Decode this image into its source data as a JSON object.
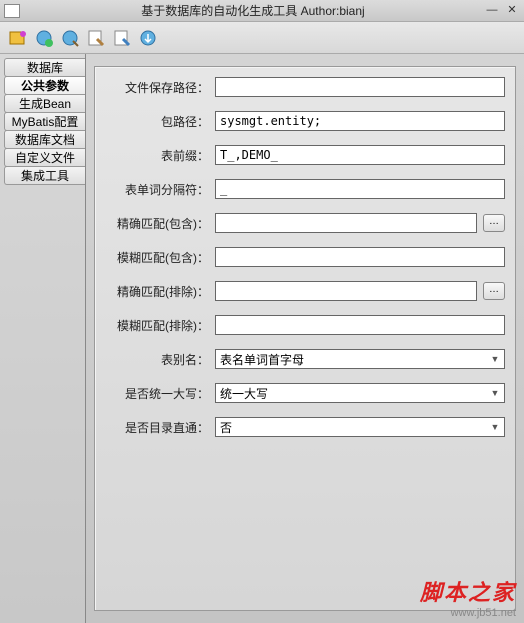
{
  "window": {
    "title": "基于数据库的自动化生成工具 Author:bianj"
  },
  "sidebar": {
    "tabs": [
      {
        "label": "数据库"
      },
      {
        "label": "公共参数"
      },
      {
        "label": "生成Bean"
      },
      {
        "label": "MyBatis配置"
      },
      {
        "label": "数据库文档"
      },
      {
        "label": "自定义文件"
      },
      {
        "label": "集成工具"
      }
    ]
  },
  "form": {
    "file_save_path": {
      "label": "文件保存路径：",
      "value": ""
    },
    "package_path": {
      "label": "包路径：",
      "value": "sysmgt.entity;"
    },
    "table_prefix": {
      "label": "表前缀：",
      "value": "T_,DEMO_"
    },
    "word_separator": {
      "label": "表单词分隔符：",
      "value": "_"
    },
    "exact_include": {
      "label": "精确匹配(包含)：",
      "value": ""
    },
    "fuzzy_include": {
      "label": "模糊匹配(包含)：",
      "value": ""
    },
    "exact_exclude": {
      "label": "精确匹配(排除)：",
      "value": ""
    },
    "fuzzy_exclude": {
      "label": "模糊匹配(排除)：",
      "value": ""
    },
    "table_alias": {
      "label": "表别名：",
      "value": "表名单词首字母"
    },
    "uppercase": {
      "label": "是否统一大写：",
      "value": "统一大写"
    },
    "dir_passthrough": {
      "label": "是否目录直通：",
      "value": "否"
    },
    "ellipsis": "…"
  },
  "watermark": {
    "line1": "脚本之家",
    "line2": "www.jb51.net"
  }
}
